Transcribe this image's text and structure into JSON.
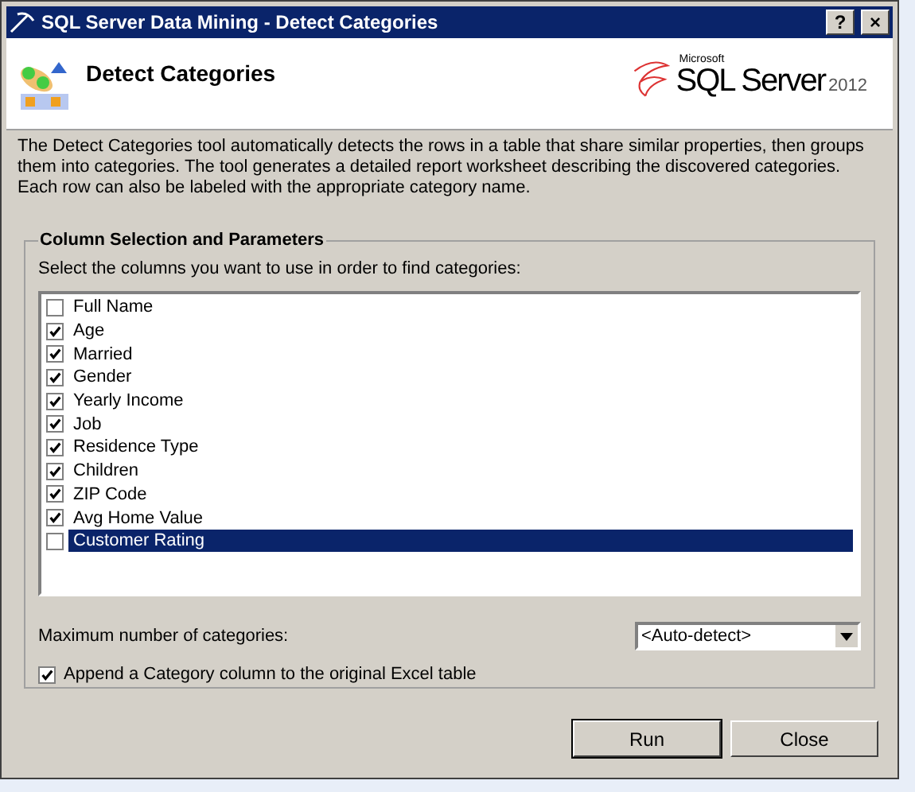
{
  "window": {
    "title": "SQL Server Data Mining - Detect Categories",
    "buttons": [
      "?",
      "×"
    ]
  },
  "header": {
    "title": "Detect Categories",
    "logo": {
      "brand": "Microsoft",
      "product": "SQL Server",
      "version": "2012"
    }
  },
  "description": "The Detect Categories tool automatically detects the rows in a table that share similar properties, then groups them into categories. The tool generates a detailed report worksheet describing the discovered categories. Each row can also be labeled with the appropriate category name.",
  "group": {
    "title": "Column Selection and Parameters",
    "prompt": "Select the columns you want to use in order to find categories:",
    "columns": [
      {
        "label": "Full Name",
        "checked": false,
        "selected": false
      },
      {
        "label": "Age",
        "checked": true,
        "selected": false
      },
      {
        "label": "Married",
        "checked": true,
        "selected": false
      },
      {
        "label": "Gender",
        "checked": true,
        "selected": false
      },
      {
        "label": "Yearly Income",
        "checked": true,
        "selected": false
      },
      {
        "label": "Job",
        "checked": true,
        "selected": false
      },
      {
        "label": "Residence Type",
        "checked": true,
        "selected": false
      },
      {
        "label": "Children",
        "checked": true,
        "selected": false
      },
      {
        "label": "ZIP Code",
        "checked": true,
        "selected": false
      },
      {
        "label": "Avg Home Value",
        "checked": true,
        "selected": false
      },
      {
        "label": "Customer Rating",
        "checked": false,
        "selected": true
      }
    ],
    "max_categories": {
      "label": "Maximum number of categories:",
      "value": "<Auto-detect>"
    },
    "append": {
      "label": "Append a Category column to the original Excel table",
      "checked": true
    }
  },
  "buttons": [
    "Run",
    "Close"
  ]
}
